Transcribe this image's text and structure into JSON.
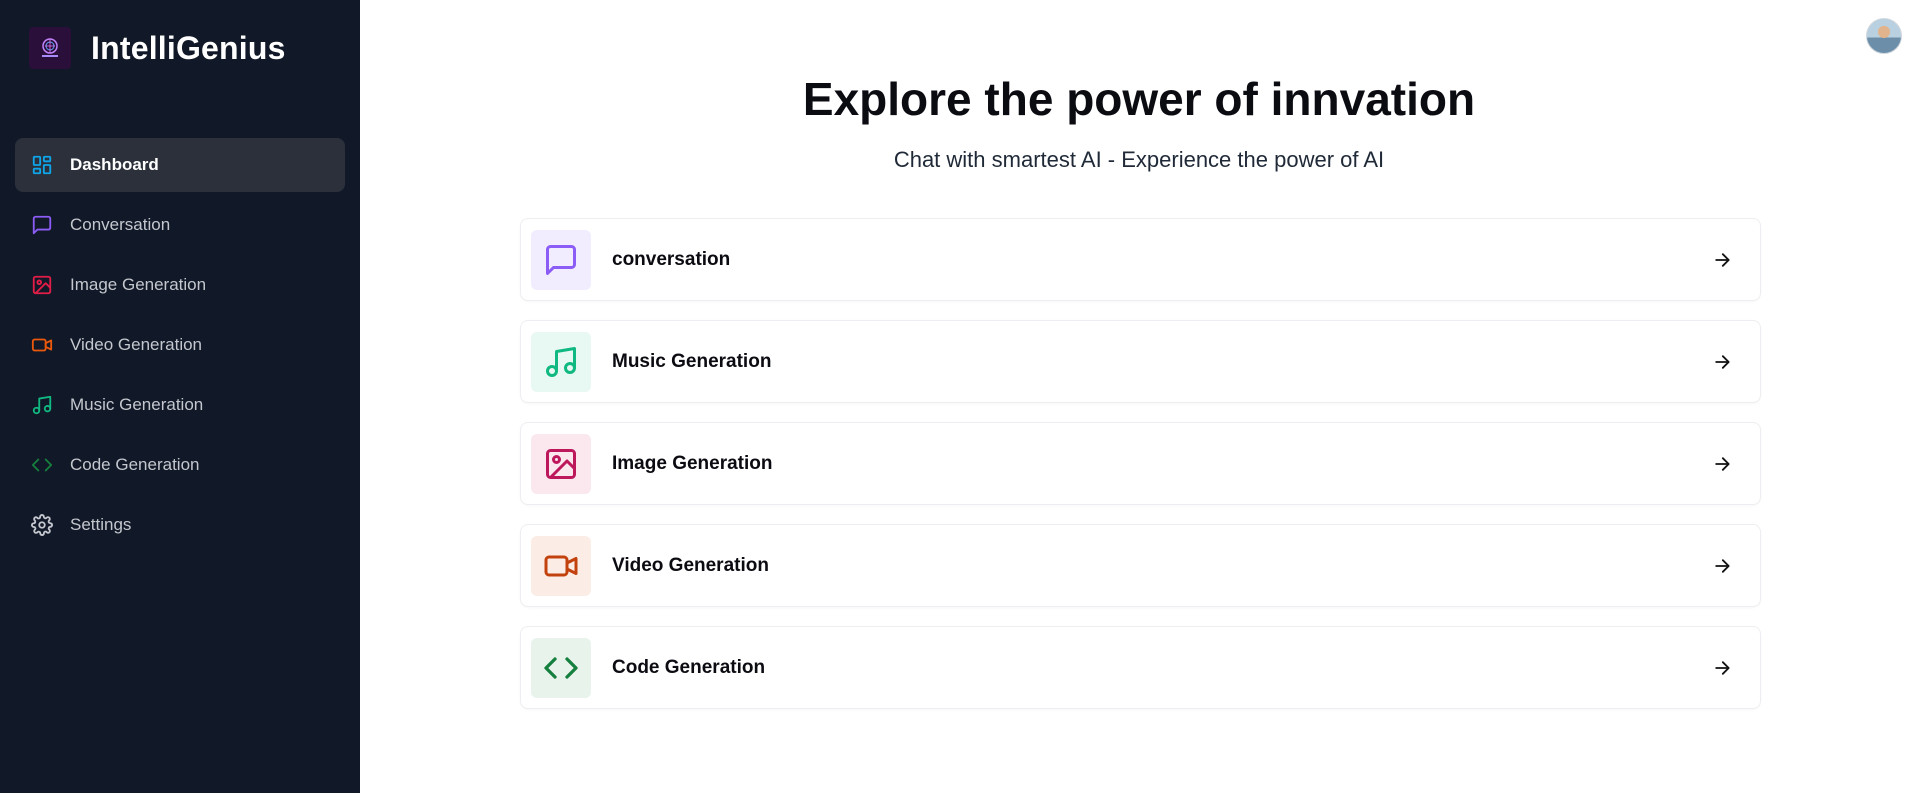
{
  "app": {
    "name": "IntelliGenius"
  },
  "sidebar": {
    "items": [
      {
        "label": "Dashboard",
        "icon": "dashboard-icon",
        "color": "#0ea5e9",
        "active": true
      },
      {
        "label": "Conversation",
        "icon": "message-square-icon",
        "color": "#8b5cf6",
        "active": false
      },
      {
        "label": "Image Generation",
        "icon": "image-icon",
        "color": "#e11d48",
        "active": false
      },
      {
        "label": "Video Generation",
        "icon": "video-icon",
        "color": "#ea580c",
        "active": false
      },
      {
        "label": "Music Generation",
        "icon": "music-icon",
        "color": "#10b981",
        "active": false
      },
      {
        "label": "Code Generation",
        "icon": "code-icon",
        "color": "#15803d",
        "active": false
      },
      {
        "label": "Settings",
        "icon": "gear-icon",
        "color": "#c4c7ce",
        "active": false
      }
    ]
  },
  "main": {
    "title": "Explore the power of innvation",
    "subtitle": "Chat with smartest AI - Experience the power of AI",
    "cards": [
      {
        "label": "conversation",
        "icon": "message-square-icon",
        "color": "#8b5cf6",
        "bg": "#f1edfe"
      },
      {
        "label": "Music Generation",
        "icon": "music-icon",
        "color": "#10b981",
        "bg": "#e8f8f2"
      },
      {
        "label": "Image Generation",
        "icon": "image-icon",
        "color": "#be185d",
        "bg": "#fbe8ef"
      },
      {
        "label": "Video Generation",
        "icon": "video-icon",
        "color": "#c2410c",
        "bg": "#fbede6"
      },
      {
        "label": "Code Generation",
        "icon": "code-icon",
        "color": "#15803d",
        "bg": "#e8f3ec"
      }
    ]
  },
  "colors": {
    "sidebar_bg": "#111827",
    "active_item_bg": "#2b303b",
    "text_dark": "#0b0b12"
  }
}
